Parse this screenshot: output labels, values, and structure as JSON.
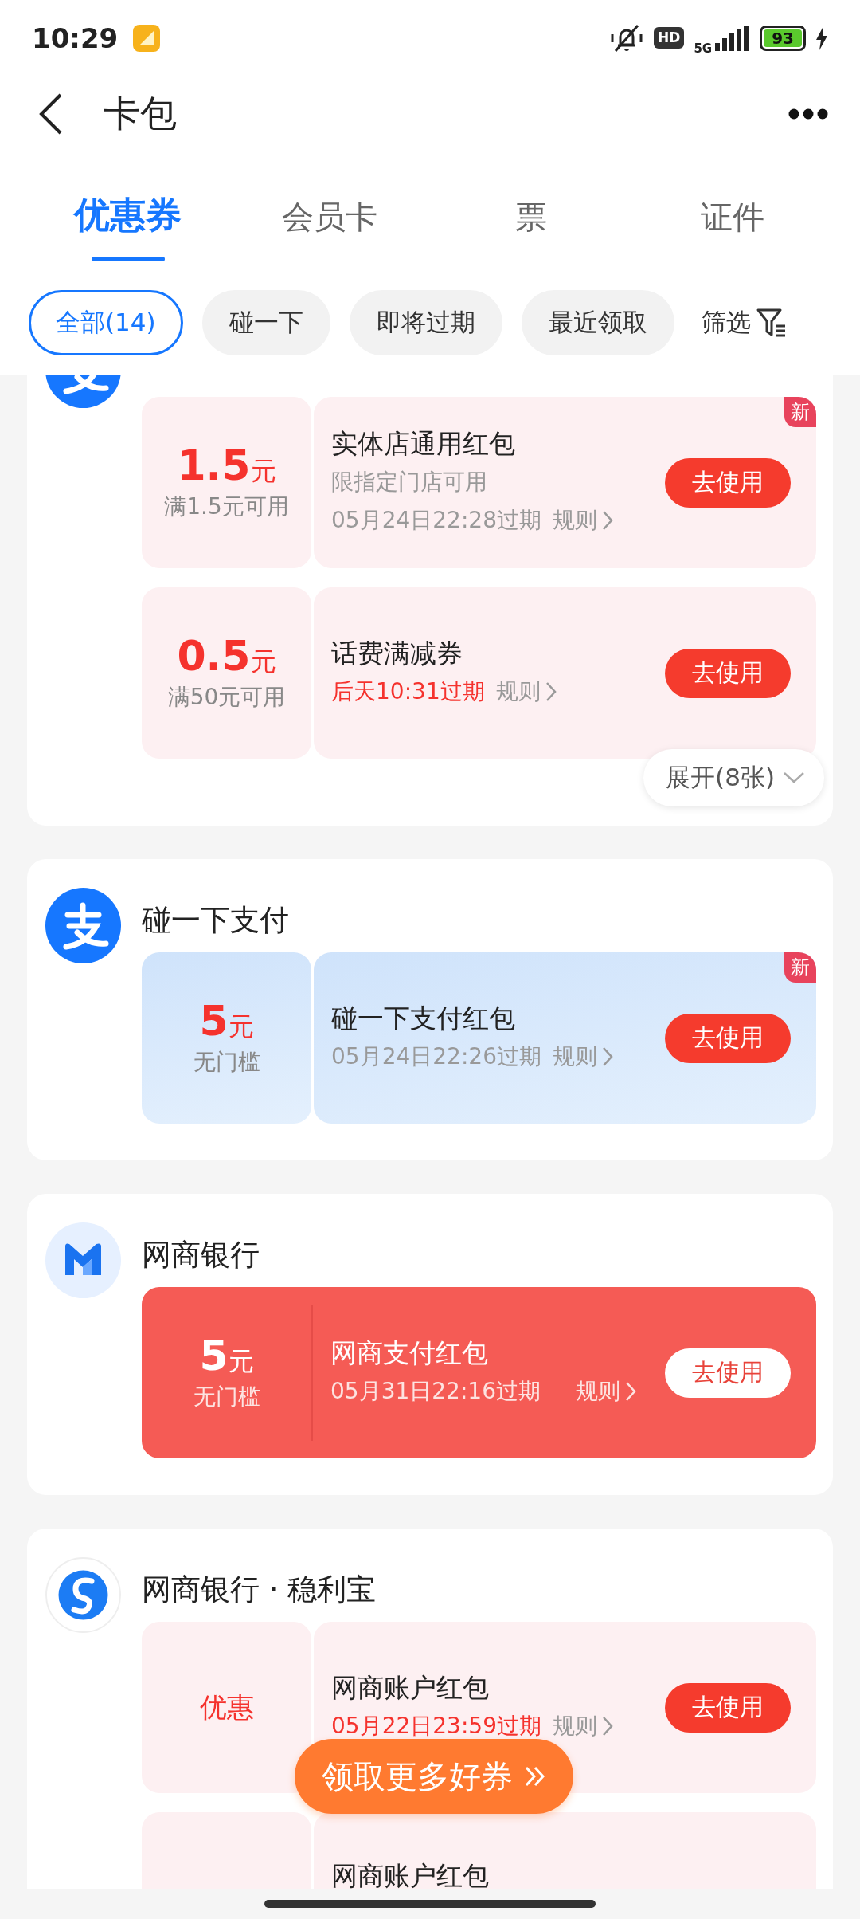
{
  "status_bar": {
    "time": "10:29",
    "hd": "HD",
    "network": "5G",
    "battery": "93"
  },
  "header": {
    "title": "卡包"
  },
  "tabs": [
    {
      "label": "优惠券",
      "selected": true
    },
    {
      "label": "会员卡",
      "selected": false
    },
    {
      "label": "票",
      "selected": false
    },
    {
      "label": "证件",
      "selected": false
    }
  ],
  "filters": [
    {
      "label": "全部(14)",
      "selected": true
    },
    {
      "label": "碰一下",
      "selected": false
    },
    {
      "label": "即将过期",
      "selected": false
    },
    {
      "label": "最近领取",
      "selected": false
    }
  ],
  "filter_button": {
    "label": "筛选"
  },
  "groups": [
    {
      "kind": "pay",
      "expand": "展开(8张)",
      "coupons": [
        {
          "kind": "pink",
          "amount": "1.5",
          "unit": "元",
          "condition": "满1.5元可用",
          "title": "实体店通用红包",
          "subtitle": "限指定门店可用",
          "expiry": "05月24日22:28过期",
          "urgent": false,
          "rule": "规则",
          "button": "去使用",
          "badge": "新"
        },
        {
          "kind": "pink",
          "amount": "0.5",
          "unit": "元",
          "condition": "满50元可用",
          "title": "话费满减券",
          "expiry": "后天10:31过期",
          "urgent": true,
          "rule": "规则",
          "button": "去使用"
        }
      ]
    },
    {
      "title": "碰一下支付",
      "kind": "pay",
      "coupons": [
        {
          "kind": "blue",
          "amount": "5",
          "unit": "元",
          "condition": "无门槛",
          "title": "碰一下支付红包",
          "expiry": "05月24日22:26过期",
          "urgent": false,
          "rule": "规则",
          "button": "去使用",
          "badge": "新"
        }
      ]
    },
    {
      "title": "网商银行",
      "kind": "bank",
      "coupons": [
        {
          "kind": "solid",
          "amount": "5",
          "unit": "元",
          "condition": "无门槛",
          "title": "网商支付红包",
          "expiry": "05月31日22:16过期",
          "urgent": false,
          "rule": "规则",
          "button": "去使用"
        }
      ]
    },
    {
      "title": "网商银行 · 稳利宝",
      "kind": "wave",
      "coupons": [
        {
          "kind": "pink",
          "label": "优惠",
          "title": "网商账户红包",
          "expiry": "05月22日23:59过期",
          "urgent": true,
          "rule": "规则",
          "button": "去使用"
        },
        {
          "kind": "pink",
          "title": "网商账户红包"
        }
      ]
    }
  ],
  "float_button": {
    "label": "领取更多好券"
  }
}
